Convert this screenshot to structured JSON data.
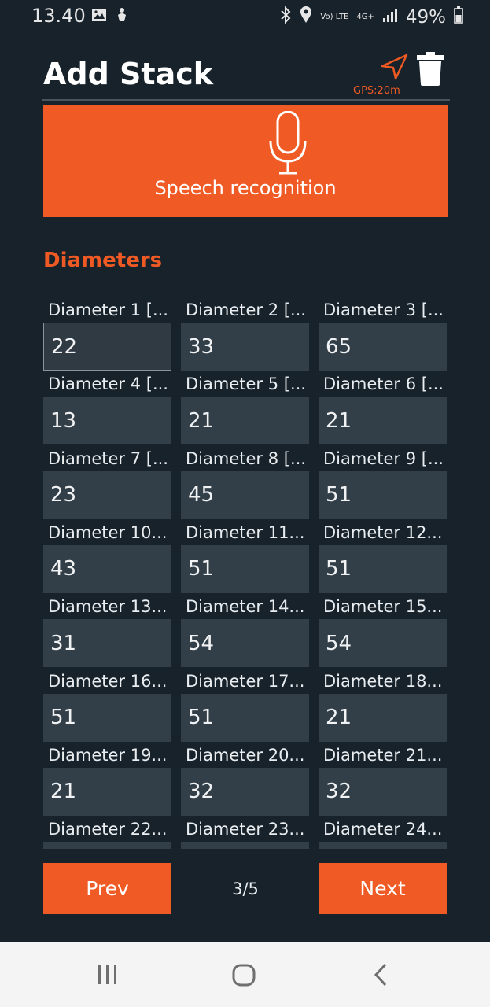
{
  "status_bar": {
    "time": "13.40",
    "network": "4G+",
    "volte": "Vo) LTE",
    "battery": "49%"
  },
  "header": {
    "title": "Add Stack",
    "gps_label": "GPS:20m"
  },
  "speech": {
    "label": "Speech recognition"
  },
  "diameters": {
    "title": "Diameters",
    "fields": [
      {
        "label": "Diameter 1 [...",
        "value": "22"
      },
      {
        "label": "Diameter 2 [...",
        "value": "33"
      },
      {
        "label": "Diameter 3 [...",
        "value": "65"
      },
      {
        "label": "Diameter 4 [...",
        "value": "13"
      },
      {
        "label": "Diameter 5 [...",
        "value": "21"
      },
      {
        "label": "Diameter 6 [...",
        "value": "21"
      },
      {
        "label": "Diameter 7 [...",
        "value": "23"
      },
      {
        "label": "Diameter 8 [...",
        "value": "45"
      },
      {
        "label": "Diameter 9 [...",
        "value": "51"
      },
      {
        "label": "Diameter 10...",
        "value": "43"
      },
      {
        "label": "Diameter 11...",
        "value": "51"
      },
      {
        "label": "Diameter 12...",
        "value": "51"
      },
      {
        "label": "Diameter 13...",
        "value": "31"
      },
      {
        "label": "Diameter 14...",
        "value": "54"
      },
      {
        "label": "Diameter 15...",
        "value": "54"
      },
      {
        "label": "Diameter 16...",
        "value": "51"
      },
      {
        "label": "Diameter 17...",
        "value": "51"
      },
      {
        "label": "Diameter 18...",
        "value": "21"
      },
      {
        "label": "Diameter 19...",
        "value": "21"
      },
      {
        "label": "Diameter 20...",
        "value": "32"
      },
      {
        "label": "Diameter 21...",
        "value": "32"
      },
      {
        "label": "Diameter 22...",
        "value": ""
      },
      {
        "label": "Diameter 23...",
        "value": ""
      },
      {
        "label": "Diameter 24...",
        "value": ""
      }
    ]
  },
  "pagination": {
    "prev_label": "Prev",
    "page": "3/5",
    "next_label": "Next"
  },
  "colors": {
    "accent": "#f05a24",
    "background": "#17222b",
    "input_bg": "#333f48"
  }
}
